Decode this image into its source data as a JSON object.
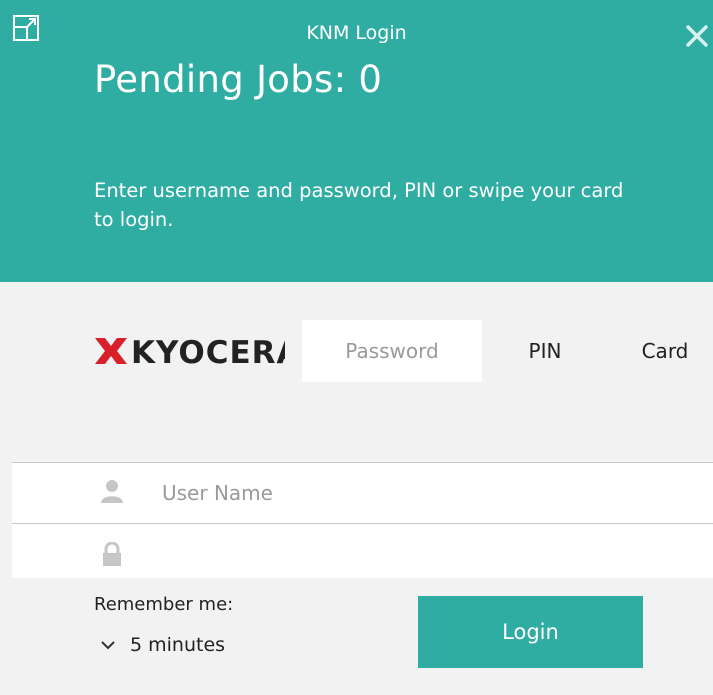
{
  "window": {
    "title": "KNM Login"
  },
  "header": {
    "pending_jobs": "Pending Jobs: 0",
    "instructions": "Enter username and password, PIN or swipe your card to login."
  },
  "brand": {
    "logo_text": "KYOCERA",
    "logo_color": "#d7202a"
  },
  "tabs": [
    {
      "label": "Password",
      "selected": true
    },
    {
      "label": "PIN",
      "selected": false
    },
    {
      "label": "Card",
      "selected": false
    }
  ],
  "form": {
    "username_placeholder": "User Name",
    "password_placeholder": "",
    "user_icon": "user-icon",
    "lock_icon": "lock-icon"
  },
  "footer": {
    "remember_label": "Remember me:",
    "remember_value": "5 minutes",
    "login_label": "Login"
  },
  "colors": {
    "accent": "#30ada3",
    "background": "#f2f2f2"
  }
}
